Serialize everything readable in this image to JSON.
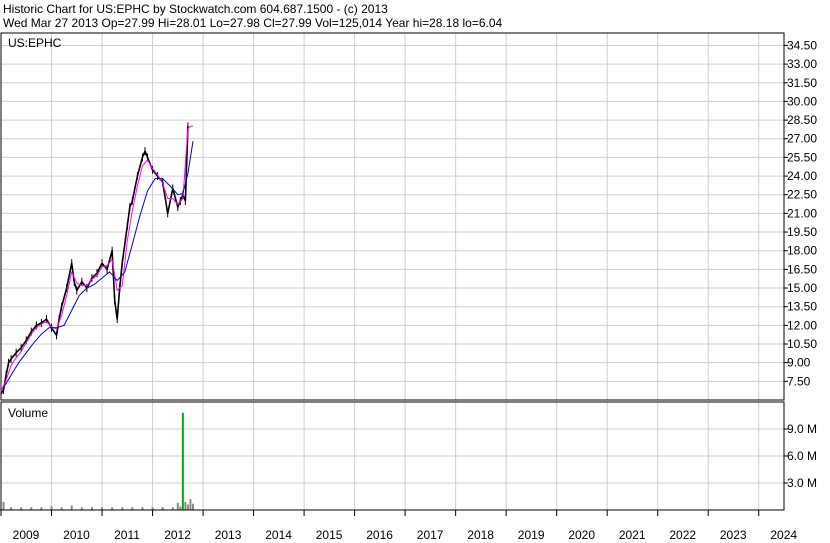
{
  "header": {
    "line1": "Historic Chart for US:EPHC by Stockwatch.com 604.687.1500 - (c) 2013",
    "line2": "Wed Mar 27 2013    Op=27.99  Hi=28.01  Lo=27.98  Cl=27.99  Vol=125,014   Year hi=28.18  lo=6.04"
  },
  "chart_data": [
    {
      "type": "line",
      "title": "US:EPHC",
      "xlabel": "",
      "ylabel": "",
      "xlim": [
        2009.0,
        2024.5
      ],
      "ylim": [
        6.0,
        35.5
      ],
      "grid": true,
      "yticks": [
        "7.50",
        "9.00",
        "10.50",
        "12.00",
        "13.50",
        "15.00",
        "16.50",
        "18.00",
        "19.50",
        "21.00",
        "22.50",
        "24.00",
        "25.50",
        "27.00",
        "28.50",
        "30.00",
        "31.50",
        "33.00",
        "34.50"
      ],
      "xticks": [
        "2009",
        "2010",
        "2011",
        "2012",
        "2013",
        "2014",
        "2015",
        "2016",
        "2017",
        "2018",
        "2019",
        "2020",
        "2021",
        "2022",
        "2023",
        "2024"
      ],
      "series": [
        {
          "color": "#000000",
          "x": [
            2009.0,
            2009.05,
            2009.1,
            2009.15,
            2009.2,
            2009.3,
            2009.4,
            2009.5,
            2009.6,
            2009.7,
            2009.8,
            2009.9,
            2010.0,
            2010.1,
            2010.15,
            2010.2,
            2010.3,
            2010.4,
            2010.45,
            2010.5,
            2010.6,
            2010.7,
            2010.8,
            2010.9,
            2011.0,
            2011.1,
            2011.2,
            2011.25,
            2011.3,
            2011.35,
            2011.4,
            2011.5,
            2011.55,
            2011.6,
            2011.7,
            2011.8,
            2011.85,
            2011.9,
            2012.0,
            2012.1,
            2012.2,
            2012.3,
            2012.4,
            2012.5,
            2012.55,
            2012.6,
            2012.65,
            2012.7
          ],
          "values": [
            6.5,
            6.8,
            8.0,
            9.0,
            9.3,
            9.8,
            10.2,
            10.8,
            11.5,
            12.0,
            12.2,
            12.5,
            11.8,
            11.2,
            12.5,
            13.5,
            15.0,
            17.0,
            15.5,
            14.8,
            15.5,
            15.0,
            15.8,
            16.2,
            17.0,
            16.5,
            18.0,
            14.0,
            12.5,
            15.0,
            17.0,
            20.0,
            21.5,
            22.0,
            24.0,
            25.5,
            26.0,
            25.5,
            24.5,
            24.0,
            23.5,
            21.0,
            23.0,
            21.5,
            22.0,
            22.5,
            22.0,
            28.0
          ]
        },
        {
          "color": "#ff00ff",
          "x": [
            2009.0,
            2009.1,
            2009.2,
            2009.3,
            2009.4,
            2009.5,
            2009.6,
            2009.7,
            2009.8,
            2009.9,
            2010.0,
            2010.1,
            2010.2,
            2010.3,
            2010.4,
            2010.5,
            2010.6,
            2010.7,
            2010.8,
            2010.9,
            2011.0,
            2011.1,
            2011.2,
            2011.3,
            2011.4,
            2011.5,
            2011.6,
            2011.7,
            2011.8,
            2011.9,
            2012.0,
            2012.1,
            2012.2,
            2012.3,
            2012.4,
            2012.5,
            2012.6,
            2012.7,
            2012.75,
            2012.8
          ],
          "values": [
            6.7,
            7.6,
            8.8,
            9.4,
            9.9,
            10.6,
            11.3,
            11.8,
            12.1,
            12.3,
            11.9,
            11.7,
            12.8,
            14.4,
            16.3,
            15.4,
            15.2,
            15.2,
            15.7,
            16.0,
            16.7,
            16.8,
            17.3,
            14.8,
            15.2,
            18.8,
            21.2,
            23.2,
            24.8,
            25.3,
            24.6,
            24.1,
            23.4,
            22.2,
            22.2,
            21.7,
            22.2,
            27.8,
            28.0,
            28.0
          ]
        },
        {
          "color": "#0000cc",
          "x": [
            2009.05,
            2009.2,
            2009.35,
            2009.5,
            2009.65,
            2009.8,
            2009.95,
            2010.1,
            2010.25,
            2010.4,
            2010.55,
            2010.7,
            2010.85,
            2011.0,
            2011.15,
            2011.3,
            2011.45,
            2011.6,
            2011.75,
            2011.9,
            2012.05,
            2012.2,
            2012.35,
            2012.5,
            2012.6,
            2012.7,
            2012.8
          ],
          "values": [
            7.0,
            8.0,
            9.0,
            9.8,
            10.6,
            11.3,
            11.8,
            11.8,
            12.0,
            13.2,
            14.4,
            15.0,
            15.3,
            15.8,
            16.3,
            15.6,
            16.3,
            18.5,
            20.8,
            22.8,
            23.8,
            23.8,
            23.2,
            22.5,
            22.6,
            24.2,
            26.8
          ]
        }
      ]
    },
    {
      "type": "bar",
      "title": "Volume",
      "ylim": [
        0,
        12.0
      ],
      "yticks": [
        "3.0 M",
        "6.0 M",
        "9.0 M"
      ],
      "x": [
        2009.05,
        2009.2,
        2009.4,
        2009.6,
        2009.8,
        2010.0,
        2010.2,
        2010.4,
        2010.6,
        2010.8,
        2011.0,
        2011.2,
        2011.4,
        2011.6,
        2011.8,
        2012.0,
        2012.2,
        2012.4,
        2012.5,
        2012.55,
        2012.6,
        2012.65,
        2012.7,
        2012.75,
        2012.8
      ],
      "values": [
        0.9,
        0.3,
        0.3,
        0.3,
        0.3,
        0.4,
        0.3,
        0.5,
        0.3,
        0.3,
        0.3,
        0.3,
        0.3,
        0.3,
        0.3,
        0.3,
        0.3,
        0.3,
        0.8,
        0.4,
        10.8,
        0.9,
        0.6,
        1.2,
        0.7
      ]
    }
  ]
}
